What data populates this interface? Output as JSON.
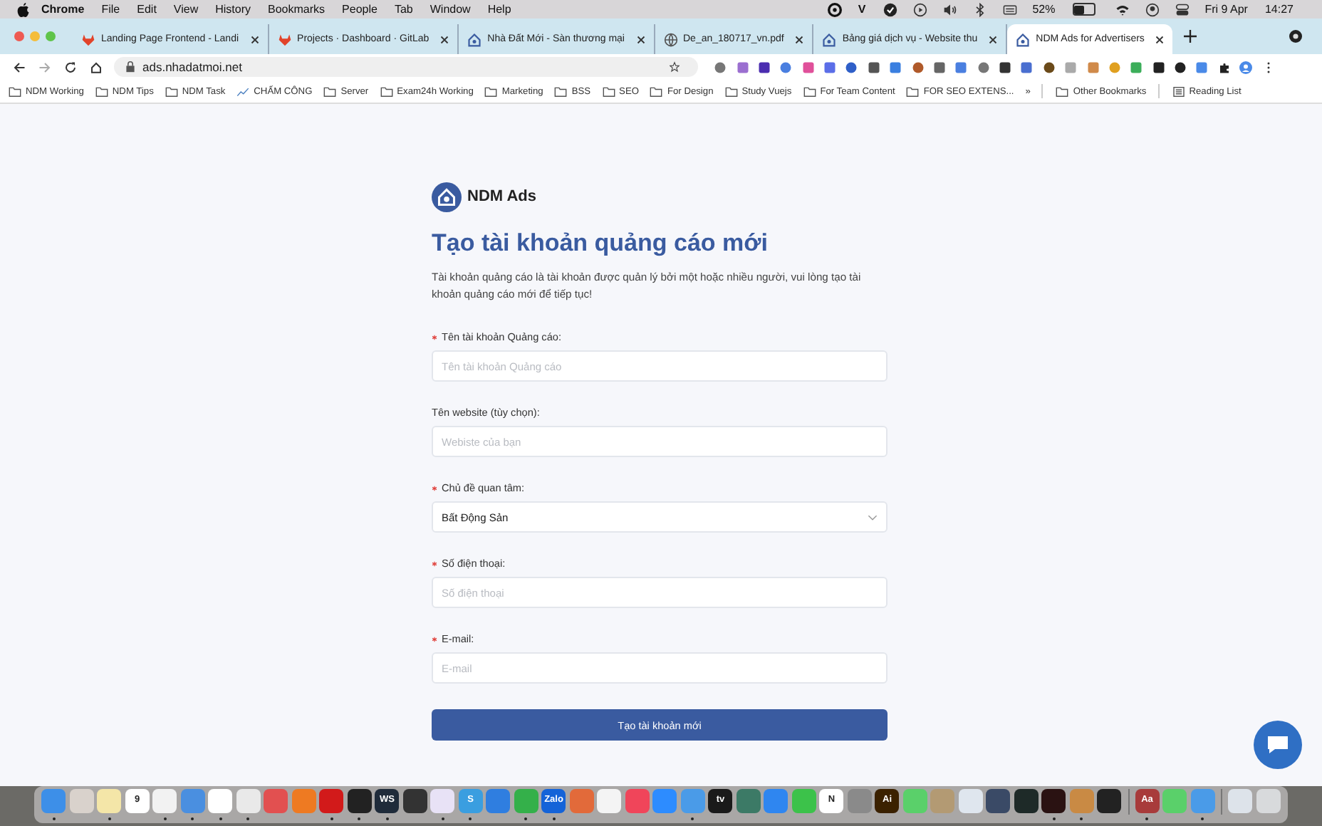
{
  "menubar": {
    "app": "Chrome",
    "menus": [
      "File",
      "Edit",
      "View",
      "History",
      "Bookmarks",
      "People",
      "Tab",
      "Window",
      "Help"
    ],
    "status_letter": "V",
    "battery": {
      "reading": "52%",
      "level": 0.52
    },
    "date": "Fri 9 Apr",
    "time": "14:27"
  },
  "tabs": [
    {
      "title": "Landing Page Frontend - Landi",
      "selected": false
    },
    {
      "title": "Projects · Dashboard · GitLab",
      "selected": false
    },
    {
      "title": "Nhà Đất Mới - Sàn thương mại",
      "selected": false
    },
    {
      "title": "De_an_180717_vn.pdf",
      "selected": false
    },
    {
      "title": "Bảng giá dịch vụ - Website thu",
      "selected": false
    },
    {
      "title": "NDM Ads for Advertisers",
      "selected": true
    }
  ],
  "address_bar": {
    "url": "ads.nhadatmoi.net"
  },
  "bookmarks": [
    {
      "label": "NDM Working",
      "kind": "folder"
    },
    {
      "label": "NDM Tips",
      "kind": "folder"
    },
    {
      "label": "NDM Task",
      "kind": "folder"
    },
    {
      "label": "CHẤM CÔNG",
      "kind": "chart"
    },
    {
      "label": "Server",
      "kind": "folder"
    },
    {
      "label": "Exam24h Working",
      "kind": "folder"
    },
    {
      "label": "Marketing",
      "kind": "folder"
    },
    {
      "label": "BSS",
      "kind": "folder"
    },
    {
      "label": "SEO",
      "kind": "folder"
    },
    {
      "label": "For Design",
      "kind": "folder"
    },
    {
      "label": "Study Vuejs",
      "kind": "folder"
    },
    {
      "label": "For Team Content",
      "kind": "folder"
    },
    {
      "label": "FOR SEO EXTENS...",
      "kind": "folder"
    }
  ],
  "bookmarks_more": "»",
  "bookmarks_right": [
    {
      "label": "Other Bookmarks",
      "kind": "folder"
    },
    {
      "label": "Reading List",
      "kind": "list"
    }
  ],
  "page": {
    "logo": "NDM Ads",
    "title": "Tạo tài khoản quảng cáo mới",
    "description": "Tài khoản quảng cáo là tài khoản được quản lý bởi một hoặc nhiều người, vui lòng tạo tài khoản quảng cáo mới để tiếp tục!",
    "fields": [
      {
        "label": "Tên tài khoản Quảng cáo:",
        "required": true,
        "kind": "input",
        "placeholder": "Tên tài khoản Quảng cáo"
      },
      {
        "label": "Tên website (tùy chọn):",
        "required": false,
        "kind": "input",
        "placeholder": "Webiste của bạn"
      },
      {
        "label": "Chủ đề quan tâm:",
        "required": true,
        "kind": "select",
        "value": "Bất Động Sản"
      },
      {
        "label": "Số điện thoại:",
        "required": true,
        "kind": "input",
        "placeholder": "Số điện thoại"
      },
      {
        "label": "E-mail:",
        "required": true,
        "kind": "input",
        "placeholder": "E-mail"
      }
    ],
    "submit": "Tạo tài khoản mới"
  },
  "dock": [
    {
      "kind": "app",
      "color": "#3d8fe8",
      "running": true
    },
    {
      "kind": "app",
      "color": "#d9d2cc",
      "running": false
    },
    {
      "kind": "app",
      "color": "#f4e6a8",
      "running": true
    },
    {
      "kind": "app",
      "color": "#ffffff",
      "label": "9",
      "running": false
    },
    {
      "kind": "app",
      "color": "#f2f2f2",
      "running": true
    },
    {
      "kind": "app",
      "color": "#4a8fe0",
      "running": true
    },
    {
      "kind": "app",
      "color": "#ffffff",
      "running": true
    },
    {
      "kind": "app",
      "color": "#e9e9e9",
      "running": true
    },
    {
      "kind": "app",
      "color": "#e25050",
      "running": false
    },
    {
      "kind": "app",
      "color": "#ee7a22",
      "running": false
    },
    {
      "kind": "app",
      "color": "#d21a1a",
      "running": true
    },
    {
      "kind": "app",
      "color": "#222222",
      "running": true
    },
    {
      "kind": "app",
      "color": "#1f2b3a",
      "label": "WS",
      "running": true
    },
    {
      "kind": "app",
      "color": "#333333",
      "running": false
    },
    {
      "kind": "app",
      "color": "#e8e2f6",
      "running": true
    },
    {
      "kind": "app",
      "color": "#3a9ee0",
      "label": "S",
      "running": true
    },
    {
      "kind": "app",
      "color": "#2f7ee0",
      "running": false
    },
    {
      "kind": "app",
      "color": "#34b04a",
      "running": true
    },
    {
      "kind": "app",
      "color": "#1463d8",
      "label": "Zalo",
      "running": true
    },
    {
      "kind": "app",
      "color": "#e26a3a",
      "running": false
    },
    {
      "kind": "app",
      "color": "#f4f4f4",
      "running": false
    },
    {
      "kind": "app",
      "color": "#f0455a",
      "running": false
    },
    {
      "kind": "app",
      "color": "#2d8cff",
      "running": false
    },
    {
      "kind": "app",
      "color": "#4a9be8",
      "running": true
    },
    {
      "kind": "app",
      "color": "#1a1a1a",
      "label": "tv",
      "running": false
    },
    {
      "kind": "app",
      "color": "#3c7a66",
      "running": false
    },
    {
      "kind": "app",
      "color": "#2f86f0",
      "running": false
    },
    {
      "kind": "app",
      "color": "#3cc24a",
      "running": false
    },
    {
      "kind": "app",
      "color": "#ffffff",
      "label": "N",
      "running": false
    },
    {
      "kind": "app",
      "color": "#8a8a8a",
      "running": false
    },
    {
      "kind": "app",
      "color": "#3b2100",
      "label": "Ai",
      "running": false
    },
    {
      "kind": "app",
      "color": "#5ad06a",
      "running": false
    },
    {
      "kind": "app",
      "color": "#b39a73",
      "running": false
    },
    {
      "kind": "app",
      "color": "#dfe6ee",
      "running": false
    },
    {
      "kind": "app",
      "color": "#3a4a66",
      "running": false
    },
    {
      "kind": "app",
      "color": "#1e2a28",
      "running": false
    },
    {
      "kind": "app",
      "color": "#2a1212",
      "running": true
    },
    {
      "kind": "app",
      "color": "#c98a44",
      "running": true
    },
    {
      "kind": "app",
      "color": "#222222",
      "running": false
    },
    {
      "kind": "separator"
    },
    {
      "kind": "app",
      "color": "#a83b3b",
      "label": "Aa",
      "running": true
    },
    {
      "kind": "app",
      "color": "#5ad06a",
      "running": false
    },
    {
      "kind": "app",
      "color": "#4a9be8",
      "running": true
    },
    {
      "kind": "separator"
    },
    {
      "kind": "app",
      "color": "#dde3ea",
      "running": false
    },
    {
      "kind": "app",
      "color": "#d8dadc",
      "running": false
    }
  ]
}
